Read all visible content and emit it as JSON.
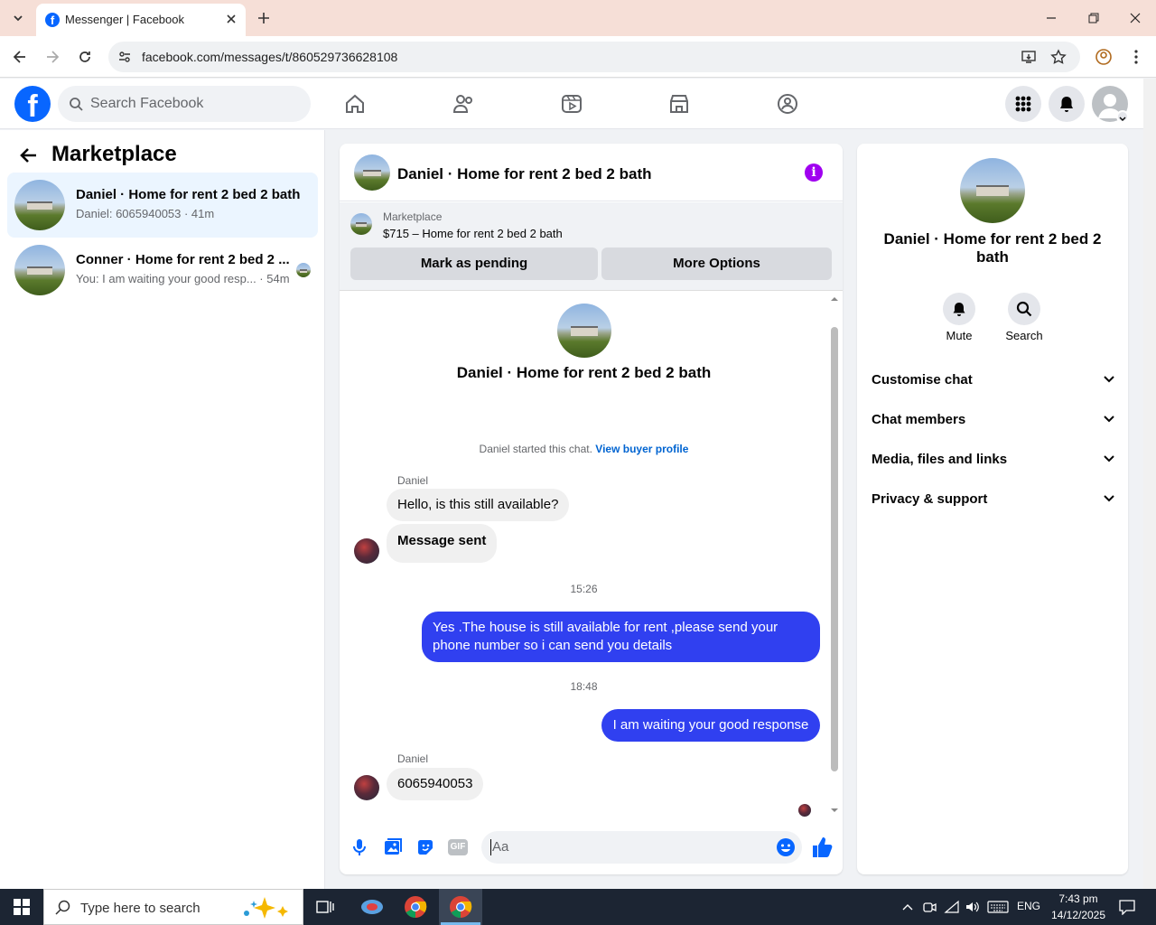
{
  "browser": {
    "tab_title": "Messenger | Facebook",
    "url": "facebook.com/messages/t/860529736628108"
  },
  "fb": {
    "search_placeholder": "Search Facebook",
    "brand_color": "#0866ff"
  },
  "left": {
    "title": "Marketplace",
    "conversations": [
      {
        "name": "Daniel · Home for rent 2 bed 2 bath",
        "preview": "Daniel: 6065940053 · 41m"
      },
      {
        "name": "Conner · Home for rent 2 bed 2 ...",
        "preview": "You: I am waiting your good resp... · 54m"
      }
    ]
  },
  "chat": {
    "header_title": "Daniel · Home for rent 2 bed 2 bath",
    "listing_source": "Marketplace",
    "listing_title": "$715 – Home for rent 2 bed 2 bath",
    "mark_pending": "Mark as pending",
    "more_options": "More Options",
    "intro_name": "Daniel · Home for rent 2 bed 2 bath",
    "started_text": "Daniel started this chat.",
    "buyer_profile": "View buyer profile",
    "sender1": "Daniel",
    "msg1": "Hello, is this still available?",
    "msg2": "Message sent",
    "time1": "15:26",
    "msg3": "Yes .The house is still available for rent ,please send your phone number so i can send you details",
    "time2": "18:48",
    "msg4": "I am waiting your good response",
    "sender2": "Daniel",
    "msg5": "6065940053",
    "composer_placeholder": "Aa",
    "outgoing_color": "#3040f0"
  },
  "details": {
    "name": "Daniel · Home for rent 2 bed 2 bath",
    "mute_label": "Mute",
    "search_label": "Search",
    "sections": [
      "Customise chat",
      "Chat members",
      "Media, files and links",
      "Privacy & support"
    ]
  },
  "taskbar": {
    "search_placeholder": "Type here to search",
    "lang": "ENG",
    "time": "7:43 pm",
    "date": "14/12/2025"
  }
}
